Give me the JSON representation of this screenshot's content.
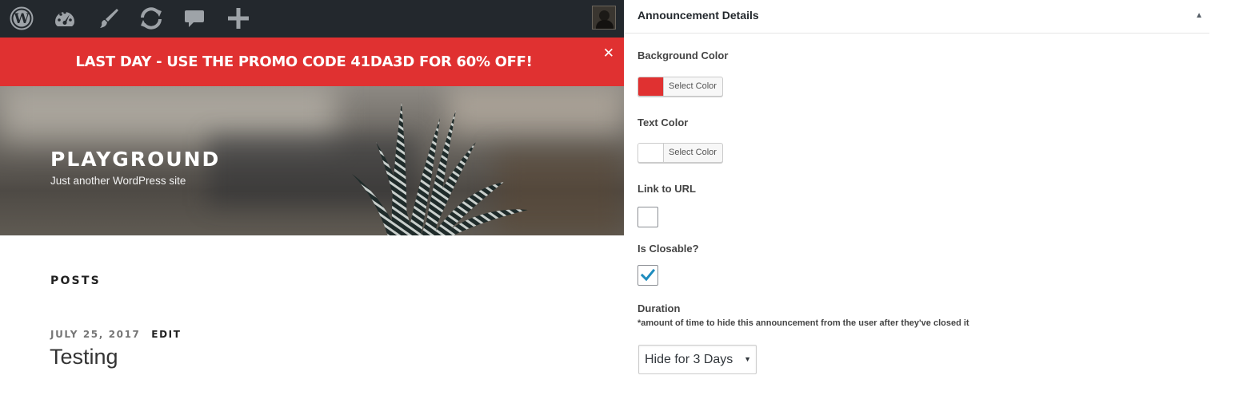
{
  "admin_bar": {
    "icons": [
      "wordpress-icon",
      "dashboard-icon",
      "customize-brush-icon",
      "updates-icon",
      "comments-icon",
      "new-content-plus-icon"
    ],
    "bg_color": "#23282d"
  },
  "announcement": {
    "text": "LAST DAY - USE THE PROMO CODE 41DA3D FOR 60% OFF!",
    "close_symbol": "✕",
    "bg_color": "#e03131",
    "text_color": "#ffffff"
  },
  "site": {
    "title": "PLAYGROUND",
    "description": "Just another WordPress site"
  },
  "content": {
    "section_heading": "POSTS",
    "post": {
      "date": "JULY 25, 2017",
      "edit_label": "EDIT",
      "title": "Testing"
    }
  },
  "panel": {
    "title": "Announcement Details",
    "collapse_symbol": "▲",
    "background_color": {
      "label": "Background Color",
      "button_label": "Select Color",
      "value": "#e03131"
    },
    "text_color": {
      "label": "Text Color",
      "button_label": "Select Color",
      "value": "#ffffff"
    },
    "link_url": {
      "label": "Link to URL",
      "value": ""
    },
    "closable": {
      "label": "Is Closable?",
      "checked": true
    },
    "duration": {
      "label": "Duration",
      "hint": "*amount of time to hide this announcement from the user after they've closed it",
      "selected": "Hide for 3 Days",
      "arrow": "▼"
    }
  }
}
